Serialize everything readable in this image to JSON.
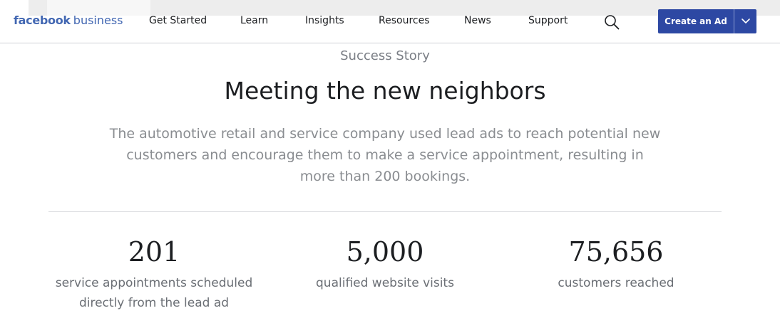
{
  "header": {
    "logo_bold": "facebook",
    "logo_light": "business",
    "nav": [
      {
        "label": "Get Started"
      },
      {
        "label": "Learn"
      },
      {
        "label": "Insights"
      },
      {
        "label": "Resources"
      },
      {
        "label": "News"
      },
      {
        "label": "Support"
      }
    ],
    "search_icon": "search-icon",
    "cta_label": "Create an Ad",
    "cta_dropdown_icon": "chevron-down-icon"
  },
  "story": {
    "eyebrow": "Success Story",
    "title": "Meeting the new neighbors",
    "description": "The automotive retail and service company used lead ads to reach potential new customers and encourage them to make a service appointment, resulting in more than 200 bookings."
  },
  "stats": [
    {
      "value": "201",
      "label": "service appointments scheduled directly from the lead ad"
    },
    {
      "value": "5,000",
      "label": "qualified website visits"
    },
    {
      "value": "75,656",
      "label": "customers reached"
    }
  ],
  "colors": {
    "brand": "#4267b2",
    "cta": "#2d48a3"
  }
}
